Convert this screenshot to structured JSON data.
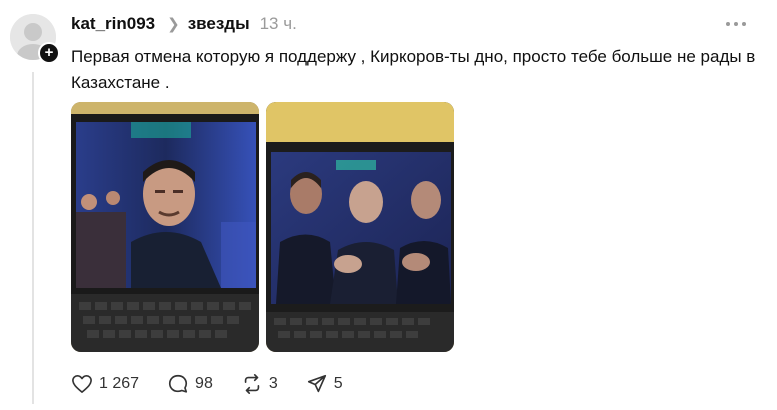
{
  "post": {
    "username": "kat_rin093",
    "topic": "звезды",
    "time": "13 ч.",
    "text": "Первая отмена которую я поддержу , Киркоров-ты дно, просто тебе больше не рады в Казахстане ."
  },
  "actions": {
    "likes": "1 267",
    "replies": "98",
    "reposts": "3",
    "shares": "5"
  },
  "icons": [
    "avatar-placeholder-icon",
    "plus-icon",
    "chevron-right-icon",
    "more-icon",
    "heart-icon",
    "comment-icon",
    "repost-icon",
    "share-icon"
  ]
}
